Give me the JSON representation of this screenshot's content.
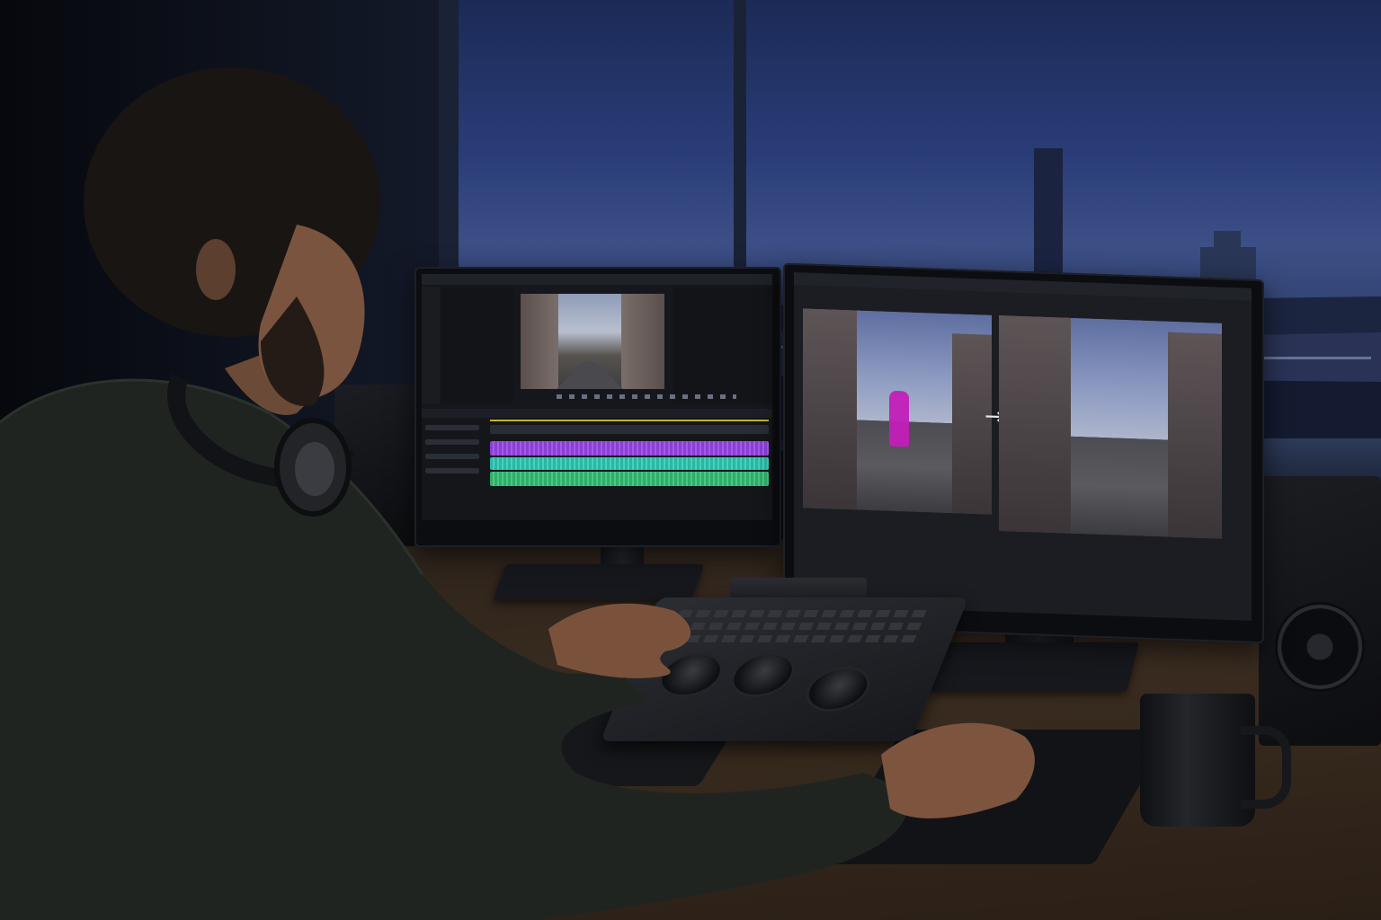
{
  "scene": {
    "description_colors": {
      "sky_dusk": "#2a3d78",
      "desk_wood": "#3a2c20",
      "sweater": "#1f2420",
      "audio_track_purple": "#8a3fd6",
      "audio_track_teal": "#2bb7a3",
      "audio_track_green": "#2fae6a",
      "segmentation_mask": "#c21fb8"
    }
  },
  "left_monitor": {
    "app": "video-editor",
    "panels": [
      "source-browser",
      "program-preview",
      "timeline"
    ],
    "tracks": [
      "video",
      "audio-1",
      "audio-2",
      "audio-3"
    ]
  },
  "right_monitor": {
    "view": "before-after-comparison",
    "arrow_glyph": "→",
    "icons": [
      "right-arrow-icon"
    ]
  },
  "icons": [
    "headphones-icon",
    "coffee-mug-icon",
    "speaker-icon",
    "editing-console-icon",
    "mouse-pad-icon"
  ]
}
